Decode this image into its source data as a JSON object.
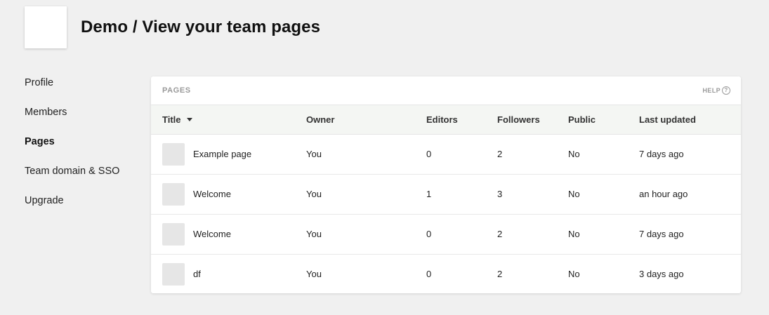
{
  "header": {
    "team_name": "Demo",
    "page_path": " / View your team pages"
  },
  "sidebar": {
    "items": [
      {
        "label": "Profile",
        "active": false
      },
      {
        "label": "Members",
        "active": false
      },
      {
        "label": "Pages",
        "active": true
      },
      {
        "label": "Team domain & SSO",
        "active": false
      },
      {
        "label": "Upgrade",
        "active": false
      }
    ]
  },
  "card": {
    "title": "PAGES",
    "help_label": "HELP",
    "help_icon": "?"
  },
  "table": {
    "columns": [
      "Title",
      "Owner",
      "Editors",
      "Followers",
      "Public",
      "Last updated"
    ],
    "rows": [
      {
        "title": "Example page",
        "owner": "You",
        "editors": "0",
        "followers": "2",
        "public": "No",
        "updated": "7 days ago"
      },
      {
        "title": "Welcome",
        "owner": "You",
        "editors": "1",
        "followers": "3",
        "public": "No",
        "updated": "an hour ago"
      },
      {
        "title": "Welcome",
        "owner": "You",
        "editors": "0",
        "followers": "2",
        "public": "No",
        "updated": "7 days ago"
      },
      {
        "title": "df",
        "owner": "You",
        "editors": "0",
        "followers": "2",
        "public": "No",
        "updated": "3 days ago"
      }
    ]
  }
}
